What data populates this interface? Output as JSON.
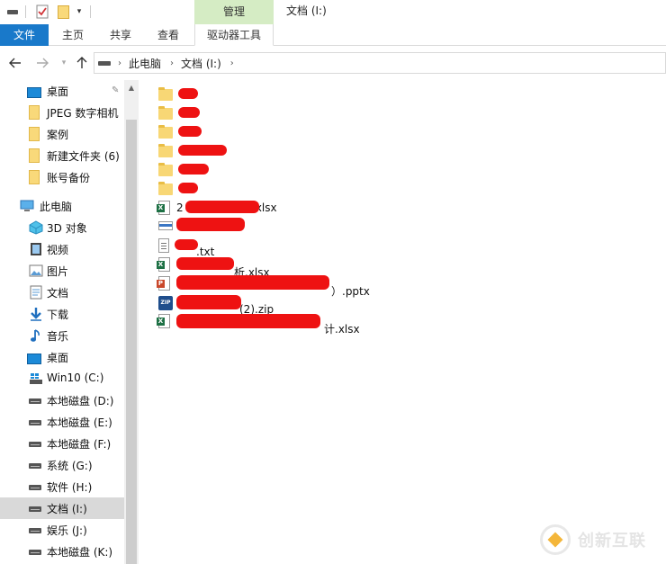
{
  "titlebar": {
    "context_tab": "管理",
    "window_title": "文档 (I:)"
  },
  "ribbon": {
    "tabs": [
      "文件",
      "主页",
      "共享",
      "查看",
      "驱动器工具"
    ]
  },
  "address": {
    "crumbs": [
      "此电脑",
      "文档 (I:)"
    ]
  },
  "nav": {
    "quick_access": [
      {
        "label": "桌面",
        "icon": "desktop-icon"
      },
      {
        "label": "JPEG 数字相机",
        "icon": "folder-icon"
      },
      {
        "label": "案例",
        "icon": "folder-icon"
      },
      {
        "label": "新建文件夹 (6)",
        "icon": "folder-icon"
      },
      {
        "label": "账号备份",
        "icon": "folder-icon"
      }
    ],
    "this_pc": "此电脑",
    "pc_items": [
      {
        "label": "3D 对象",
        "icon": "3d-objects-icon"
      },
      {
        "label": "视频",
        "icon": "video-icon"
      },
      {
        "label": "图片",
        "icon": "pictures-icon"
      },
      {
        "label": "文档",
        "icon": "documents-icon"
      },
      {
        "label": "下载",
        "icon": "downloads-icon"
      },
      {
        "label": "音乐",
        "icon": "music-icon"
      },
      {
        "label": "桌面",
        "icon": "desktop-icon"
      },
      {
        "label": "Win10 (C:)",
        "icon": "windows-drive-icon"
      },
      {
        "label": "本地磁盘 (D:)",
        "icon": "drive-icon"
      },
      {
        "label": "本地磁盘 (E:)",
        "icon": "drive-icon"
      },
      {
        "label": "本地磁盘 (F:)",
        "icon": "drive-icon"
      },
      {
        "label": "系统 (G:)",
        "icon": "drive-icon"
      },
      {
        "label": "软件 (H:)",
        "icon": "drive-icon"
      },
      {
        "label": "文档 (I:)",
        "icon": "drive-icon",
        "selected": true
      },
      {
        "label": "娱乐 (J:)",
        "icon": "drive-icon"
      },
      {
        "label": "本地磁盘 (K:)",
        "icon": "drive-icon"
      }
    ]
  },
  "files": [
    {
      "type": "folder",
      "visible_name": ""
    },
    {
      "type": "folder",
      "visible_name": ""
    },
    {
      "type": "folder",
      "visible_name": ""
    },
    {
      "type": "folder",
      "visible_name": ""
    },
    {
      "type": "folder",
      "visible_name": ""
    },
    {
      "type": "folder",
      "visible_name": ""
    },
    {
      "type": "xlsx",
      "visible_name": "2",
      "suffix": ".xlsx"
    },
    {
      "type": "generic",
      "visible_name": ""
    },
    {
      "type": "txt",
      "visible_name": "",
      "suffix": ".txt"
    },
    {
      "type": "xlsx",
      "visible_name": "",
      "suffix": "析.xlsx"
    },
    {
      "type": "pptx",
      "visible_name": "",
      "suffix": "）.pptx"
    },
    {
      "type": "zip",
      "visible_name": "",
      "suffix": "(2).zip"
    },
    {
      "type": "xlsx",
      "visible_name": "",
      "suffix": "计.xlsx"
    }
  ],
  "watermark": {
    "text": "创新互联"
  }
}
